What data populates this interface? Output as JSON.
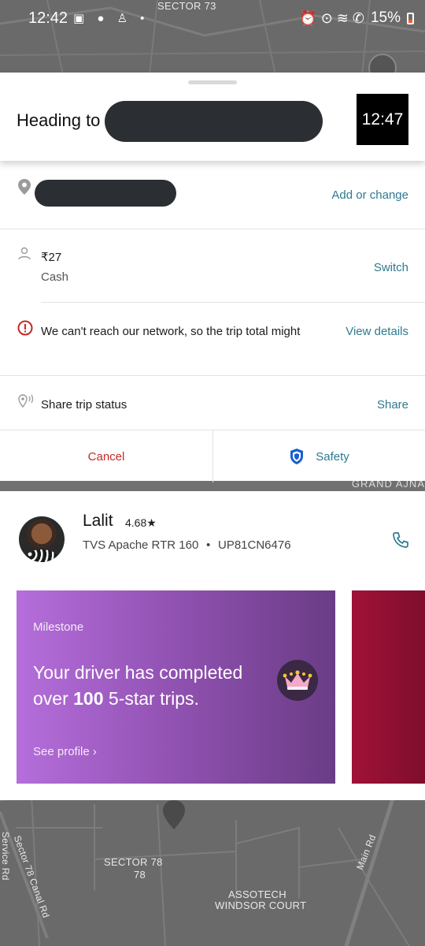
{
  "status_bar": {
    "time": "12:42",
    "left_icons": "▣ ● ♙ •",
    "right_icons": "⏰ ⊙ ≋ ✆",
    "battery": "15%"
  },
  "map_top": {
    "label_sector73": "SECTOR 73"
  },
  "header": {
    "heading": "Heading to",
    "eta": "12:47"
  },
  "destination": {
    "action": "Add or change"
  },
  "payment": {
    "amount": "₹27",
    "method": "Cash",
    "action": "Switch"
  },
  "network_warning": {
    "message": "We can't reach our network, so the trip total might",
    "action": "View details"
  },
  "share": {
    "label": "Share trip status",
    "action": "Share"
  },
  "buttons": {
    "cancel": "Cancel",
    "safety": "Safety"
  },
  "gap_strip": {
    "label": "GRAND AJNA"
  },
  "driver": {
    "name": "Lalit",
    "rating": "4.68★",
    "vehicle": "TVS Apache RTR 160",
    "separator": "•",
    "plate": "UP81CN6476"
  },
  "milestone": {
    "title": "Milestone",
    "body_pre": "Your driver has completed over ",
    "body_bold": "100",
    "body_post": " 5-star trips.",
    "link": "See profile ›"
  },
  "map_bottom": {
    "sector78": "SECTOR 78",
    "sector78_num": "78",
    "assotech_1": "ASSOTECH",
    "assotech_2": "WINDSOR COURT",
    "canal_rd": "Sector 78 Canal Rd",
    "service_rd": "Service Rd",
    "main_rd": "Main Rd"
  },
  "colors": {
    "link": "#2e7a8f",
    "cancel": "#c62828",
    "milestone_start": "#b56edb",
    "milestone_end": "#6a3c86",
    "next_card": "#a01238"
  }
}
